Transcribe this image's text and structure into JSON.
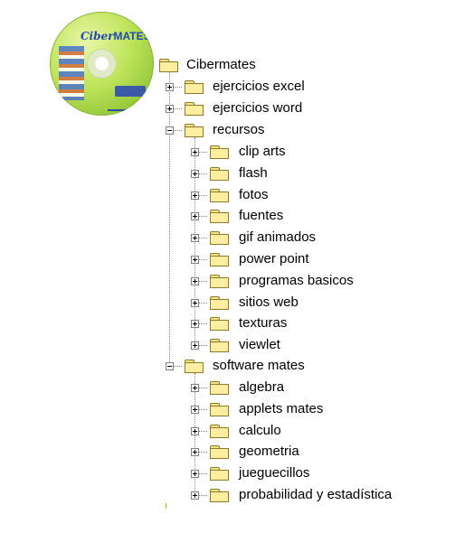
{
  "cd": {
    "title_prefix": "Ciber",
    "title_suffix": "MATES",
    "icon": "cd-artwork-icon"
  },
  "tree": {
    "root": {
      "label": "Cibermates",
      "expanded": true,
      "icon": "folder-open-icon"
    },
    "items": [
      {
        "label": "ejercicios excel",
        "expanded": false,
        "icon": "folder-icon"
      },
      {
        "label": "ejercicios word",
        "expanded": false,
        "icon": "folder-icon"
      },
      {
        "label": "recursos",
        "expanded": true,
        "icon": "folder-icon",
        "children": [
          "clip arts",
          "flash",
          "fotos",
          "fuentes",
          "gif animados",
          "power point",
          "programas basicos",
          "sitios web",
          "texturas",
          "viewlet"
        ]
      },
      {
        "label": "software mates",
        "expanded": true,
        "icon": "folder-icon",
        "children": [
          "algebra",
          "applets mates",
          "calculo",
          "geometria",
          "jueguecillos",
          "probabilidad y estadística"
        ]
      }
    ]
  }
}
